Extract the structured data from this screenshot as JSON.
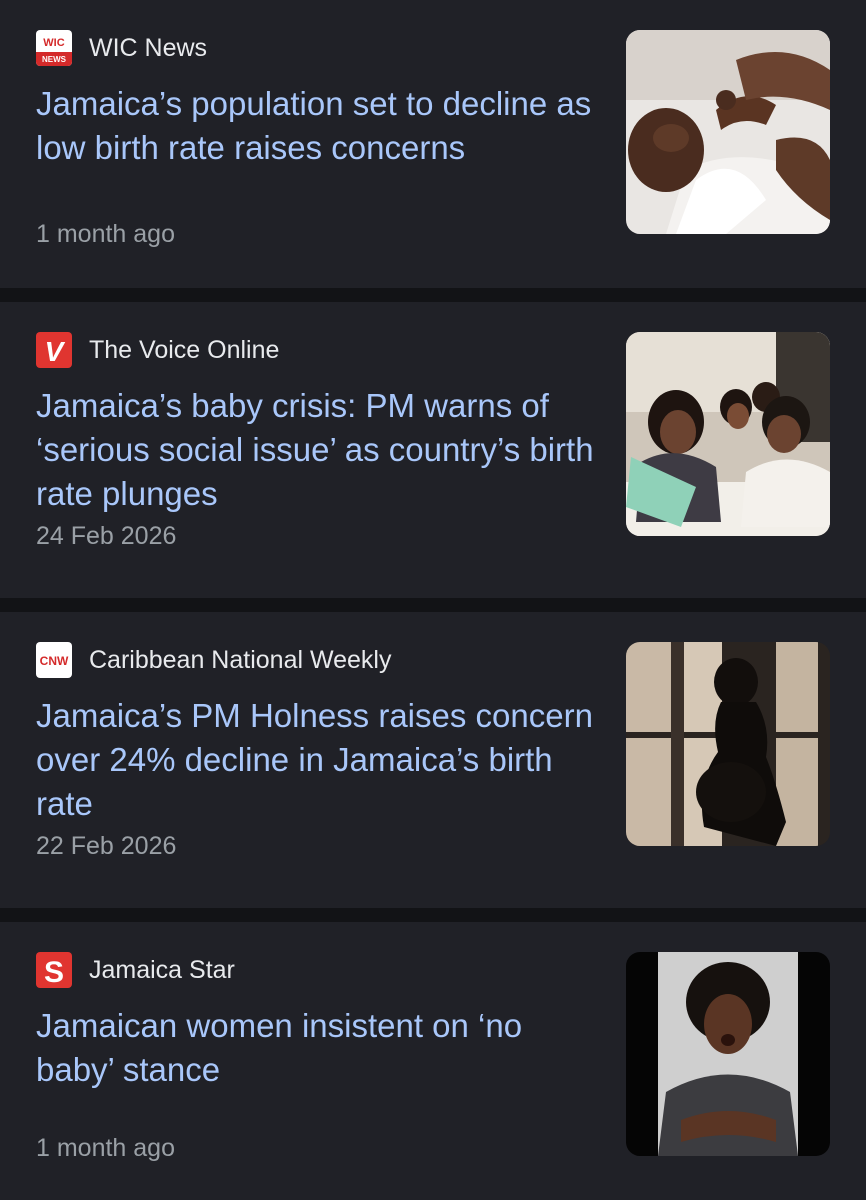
{
  "articles": [
    {
      "source": "WIC News",
      "source_logo": "wic-news-logo",
      "logo_text": "WIC NEWS",
      "headline": "Jamaica’s population set to decline as low birth rate raises concerns",
      "time": "1 month ago",
      "thumbnail": "baby-lying-with-hands-photo"
    },
    {
      "source": "The Voice Online",
      "source_logo": "voice-online-logo",
      "logo_text": "V",
      "headline": "Jamaica’s baby crisis: PM warns of ‘serious social issue’ as country’s birth rate plunges",
      "time": "24 Feb 2026",
      "thumbnail": "family-reading-book-photo"
    },
    {
      "source": "Caribbean National Weekly",
      "source_logo": "cnw-logo",
      "logo_text": "CNW",
      "headline": "Jamaica’s PM Holness raises concern over 24% decline in Jamaica’s birth rate",
      "time": "22 Feb 2026",
      "thumbnail": "pregnant-woman-silhouette-photo"
    },
    {
      "source": "Jamaica Star",
      "source_logo": "jamaica-star-logo",
      "logo_text": "S",
      "headline": "Jamaican women insistent on ‘no baby’ stance",
      "time": "1 month ago",
      "thumbnail": "angry-woman-arms-crossed-photo"
    }
  ],
  "colors": {
    "page_background": "#121316",
    "card_background": "#202127",
    "headline": "#a9c7fa",
    "source_name": "#e8eaed",
    "timestamp": "#9aa0a6"
  }
}
